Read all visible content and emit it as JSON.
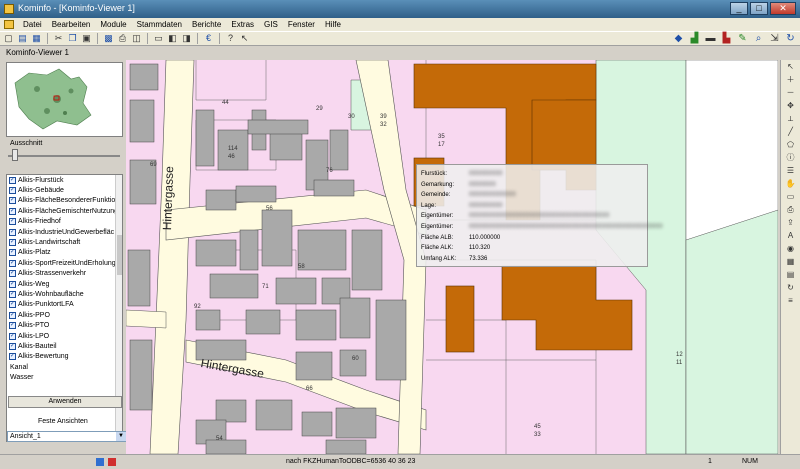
{
  "window": {
    "title": "Kominfo - [Kominfo-Viewer 1]"
  },
  "window_controls": {
    "minimize": "_",
    "maximize": "□",
    "close": "✕"
  },
  "menu": [
    "Datei",
    "Bearbeiten",
    "Module",
    "Stammdaten",
    "Berichte",
    "Extras",
    "GIS",
    "Fenster",
    "Hilfe"
  ],
  "subwindow": {
    "title": "Kominfo-Viewer 1"
  },
  "left": {
    "zoom_label": "Ausschnitt",
    "layers": [
      "Alkis-Flurstück",
      "Alkis-Gebäude",
      "Alkis-FlächeBesondererFunktio",
      "Alkis-FlächeGemischterNutzung",
      "Alkis-Friedhof",
      "Alkis-IndustrieUndGewerbefläc",
      "Alkis-Landwirtschaft",
      "Alkis-Platz",
      "Alkis-SportFreizeitUndErholung",
      "Alkis-Strassenverkehr",
      "Alkis-Weg",
      "Alkis-Wohnbaufläche",
      "Alkis-PunktortLFA",
      "Alkis-PPO",
      "Alkis-PTO",
      "Alkis-LPO",
      "Alkis-Bauteil",
      "Alkis-Bewertung"
    ],
    "extra_items": [
      "Kanal",
      "Wasser"
    ],
    "apply_button": "Anwenden",
    "views_label": "Feste Ansichten",
    "views_selected": "Ansicht_1"
  },
  "map": {
    "streets": {
      "top": "Hintergasse",
      "bottom": "Hintergasse"
    },
    "lot_labels": [
      "44",
      "29",
      "30",
      "39",
      "32",
      "35",
      "17",
      "114",
      "46",
      "76",
      "69",
      "56",
      "58",
      "71",
      "92",
      "60",
      "66",
      "45",
      "33",
      "12",
      "11",
      "54"
    ]
  },
  "info": {
    "rows": [
      {
        "label": "Flurstück:",
        "value": "0000000000",
        "hidden": true
      },
      {
        "label": "Gemarkung:",
        "value": "00000000",
        "hidden": true
      },
      {
        "label": "Gemeinde:",
        "value": "00000000000000",
        "hidden": true
      },
      {
        "label": "Lage:",
        "value": "0000000000",
        "hidden": true
      },
      {
        "label": "Eigentümer:",
        "value": "000000000000000000000000000000000000000000",
        "hidden": true
      },
      {
        "label": "Eigentümer:",
        "value": "0000000000000000000000000000000000000000000000000000000000",
        "hidden": true
      },
      {
        "label": "Fläche ALB:",
        "value": "110.000000",
        "hidden": false
      },
      {
        "label": "Fläche ALK:",
        "value": "110.320",
        "hidden": false
      },
      {
        "label": "Umfang ALK:",
        "value": "73.336",
        "hidden": false
      }
    ]
  },
  "status": {
    "text": "nach FKZHumanToODBC=6536 40   36   23",
    "page": "1",
    "mode": "NUM"
  },
  "colors": {
    "residential": "#f8d8f0",
    "building": "#a9a9a9",
    "industrial_building": "#c46a08",
    "green": "#d8f5e0",
    "road": "#fffbe0"
  }
}
